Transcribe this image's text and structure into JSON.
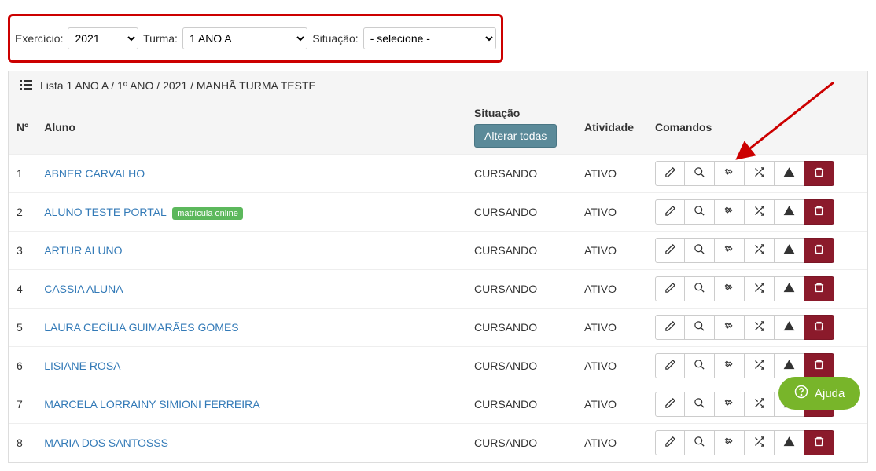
{
  "filters": {
    "exercicio_label": "Exercício:",
    "exercicio_value": "2021",
    "turma_label": "Turma:",
    "turma_value": "1 ANO A",
    "situacao_label": "Situação:",
    "situacao_value": "- selecione -"
  },
  "panel": {
    "title": "Lista 1 ANO A / 1º ANO / 2021 / MANHÃ TURMA TESTE"
  },
  "columns": {
    "num": "Nº",
    "aluno": "Aluno",
    "situacao": "Situação",
    "alterar_todas": "Alterar todas",
    "atividade": "Atividade",
    "comandos": "Comandos"
  },
  "badge_matricula_online": "matrícula online",
  "rows": [
    {
      "n": "1",
      "aluno": "ABNER CARVALHO",
      "badge": false,
      "situacao": "CURSANDO",
      "atividade": "ATIVO"
    },
    {
      "n": "2",
      "aluno": "ALUNO TESTE PORTAL",
      "badge": true,
      "situacao": "CURSANDO",
      "atividade": "ATIVO"
    },
    {
      "n": "3",
      "aluno": "ARTUR ALUNO",
      "badge": false,
      "situacao": "CURSANDO",
      "atividade": "ATIVO"
    },
    {
      "n": "4",
      "aluno": "CASSIA ALUNA",
      "badge": false,
      "situacao": "CURSANDO",
      "atividade": "ATIVO"
    },
    {
      "n": "5",
      "aluno": "LAURA CECÍLIA GUIMARÃES GOMES",
      "badge": false,
      "situacao": "CURSANDO",
      "atividade": "ATIVO"
    },
    {
      "n": "6",
      "aluno": "LISIANE ROSA",
      "badge": false,
      "situacao": "CURSANDO",
      "atividade": "ATIVO"
    },
    {
      "n": "7",
      "aluno": "MARCELA LORRAINY SIMIONI FERREIRA",
      "badge": false,
      "situacao": "CURSANDO",
      "atividade": "ATIVO"
    },
    {
      "n": "8",
      "aluno": "MARIA DOS SANTOSSS",
      "badge": false,
      "situacao": "CURSANDO",
      "atividade": "ATIVO"
    }
  ],
  "help": {
    "label": "Ajuda"
  }
}
